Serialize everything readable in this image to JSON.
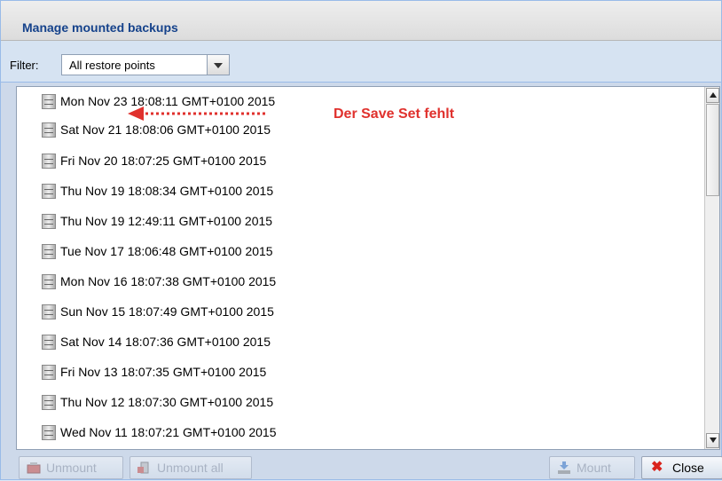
{
  "window": {
    "title": "Manage mounted backups"
  },
  "filter": {
    "label": "Filter:",
    "selected": "All restore points"
  },
  "list": {
    "items": [
      "Mon Nov 23 18:08:11 GMT+0100 2015",
      "Sat Nov 21 18:08:06 GMT+0100 2015",
      "Fri Nov 20 18:07:25 GMT+0100 2015",
      "Thu Nov 19 18:08:34 GMT+0100 2015",
      "Thu Nov 19 12:49:11 GMT+0100 2015",
      "Tue Nov 17 18:06:48 GMT+0100 2015",
      "Mon Nov 16 18:07:38 GMT+0100 2015",
      "Sun Nov 15 18:07:49 GMT+0100 2015",
      "Sat Nov 14 18:07:36 GMT+0100 2015",
      "Fri Nov 13 18:07:35 GMT+0100 2015",
      "Thu Nov 12 18:07:30 GMT+0100 2015",
      "Wed Nov 11 18:07:21 GMT+0100 2015"
    ]
  },
  "annotation": {
    "text": "Der Save Set fehlt",
    "color": "#e0312d"
  },
  "buttons": {
    "unmount": "Unmount",
    "unmount_all": "Unmount all",
    "mount": "Mount",
    "close": "Close"
  },
  "icons": {
    "filter_dropdown": "chevron-down-icon",
    "row": "server-icon",
    "unmount": "drive-eject-icon",
    "unmount_all": "server-eject-icon",
    "mount": "mount-download-icon",
    "close": "close-x-icon"
  }
}
